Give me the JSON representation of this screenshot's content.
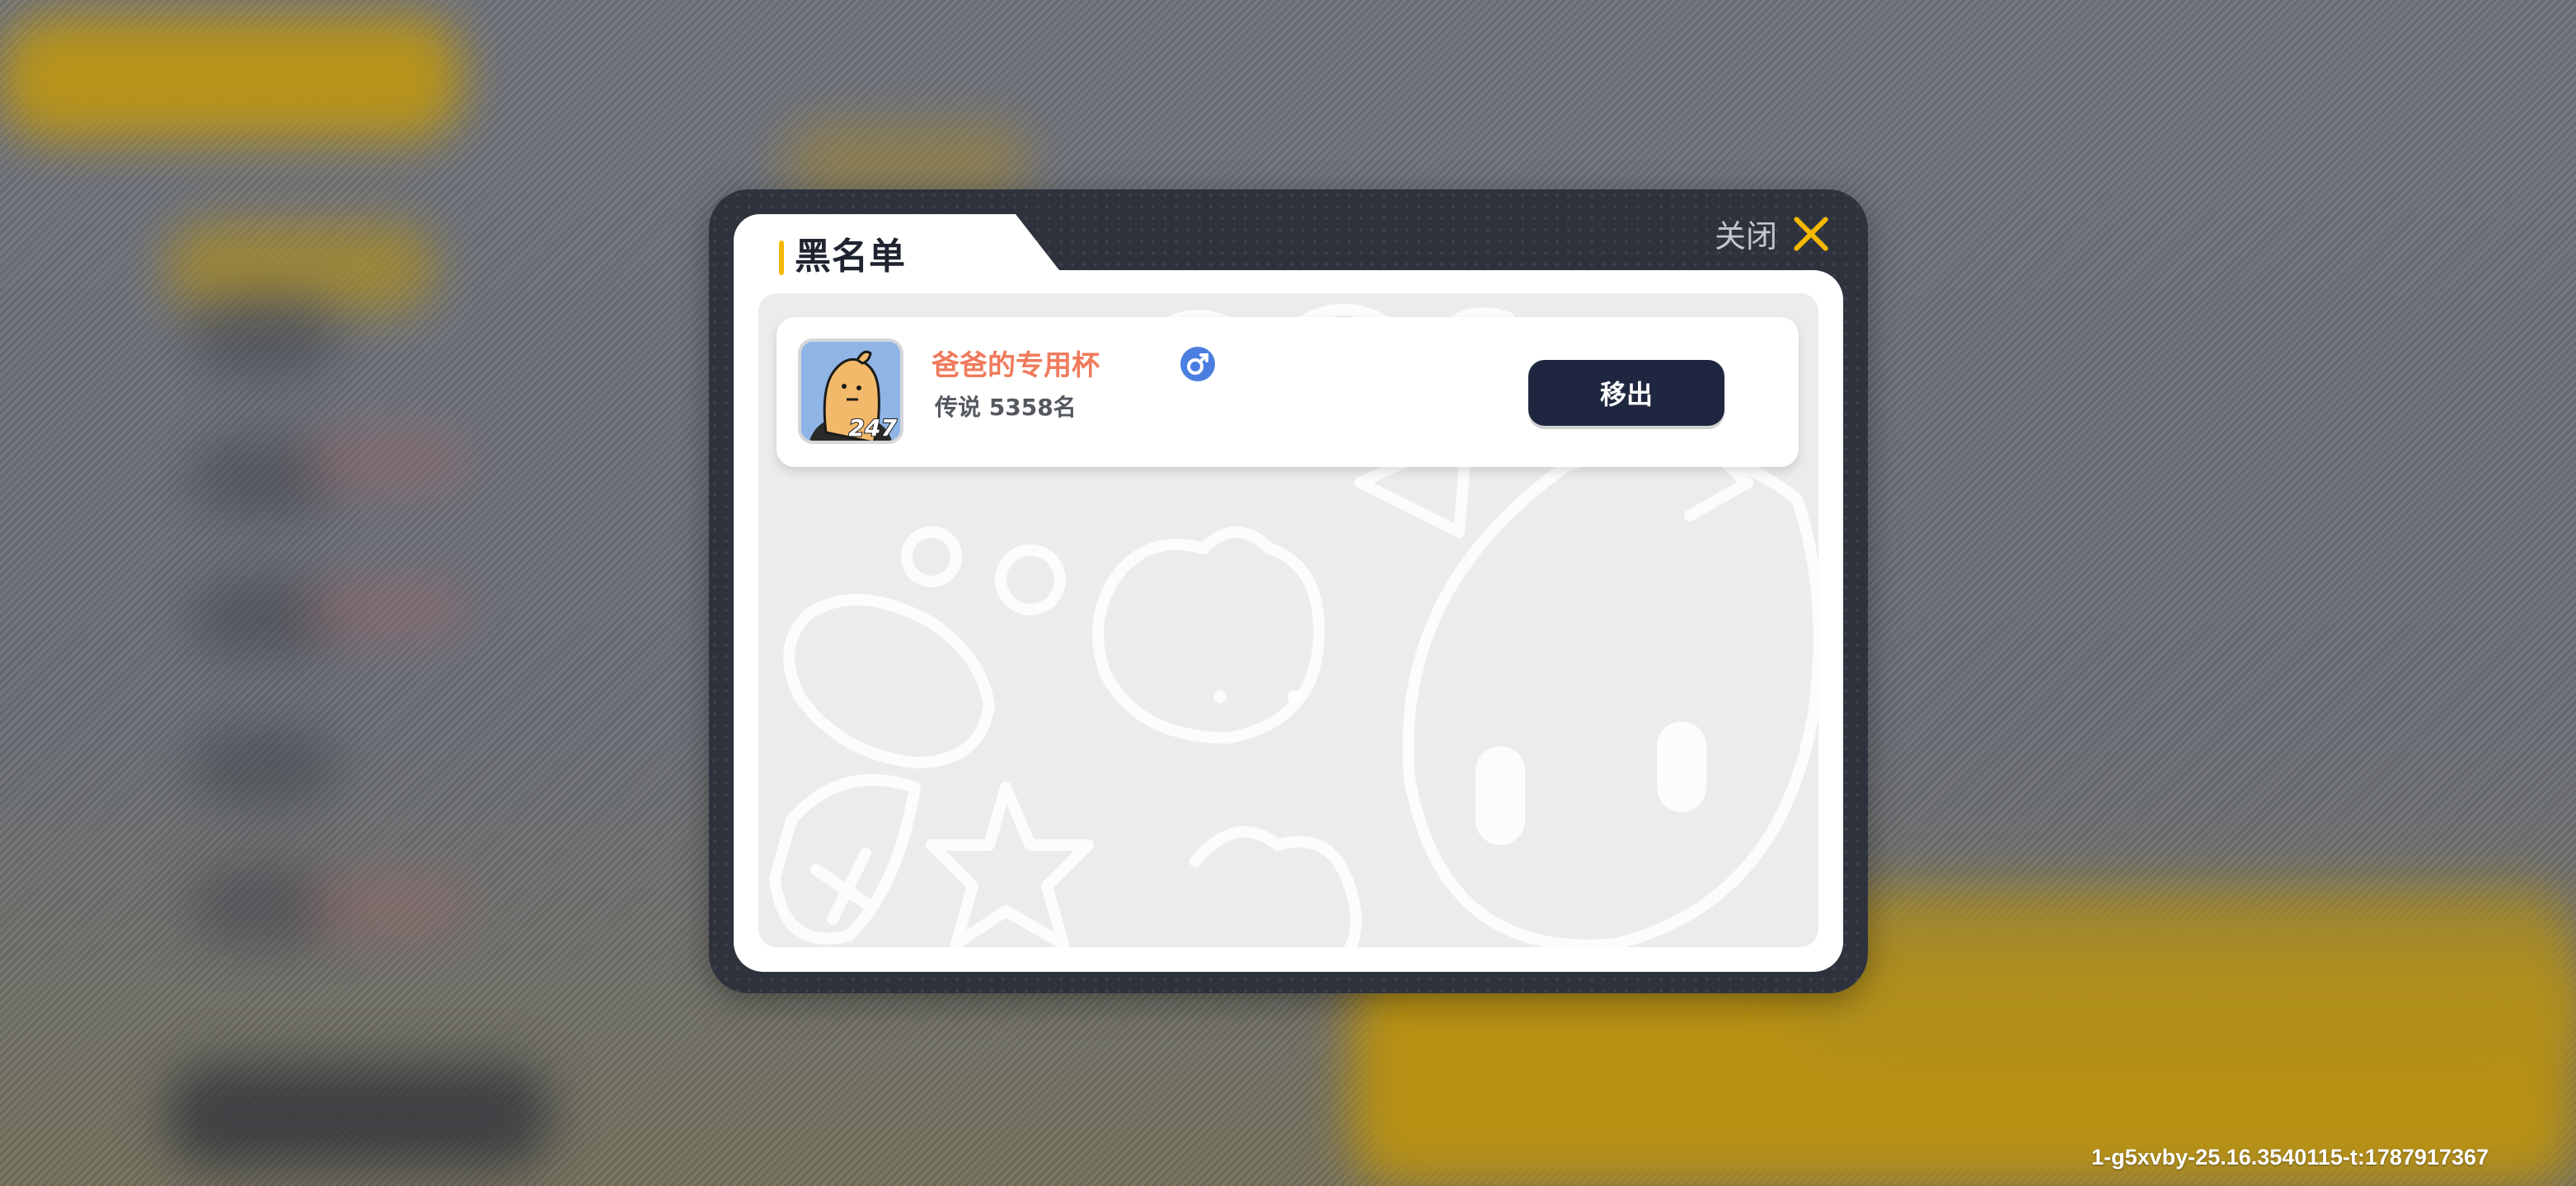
{
  "modal": {
    "title": "黑名单",
    "close_label": "关闭",
    "accent_color": "#f5b800"
  },
  "blacklist": [
    {
      "name": "爸爸的专用杯",
      "gender_icon": "male-icon",
      "rank": "传说 5358名",
      "avatar_level": "247",
      "action_label": "移出"
    }
  ],
  "footer": {
    "build_info": "1-g5xvby-25.16.3540115-t:1787917367"
  }
}
